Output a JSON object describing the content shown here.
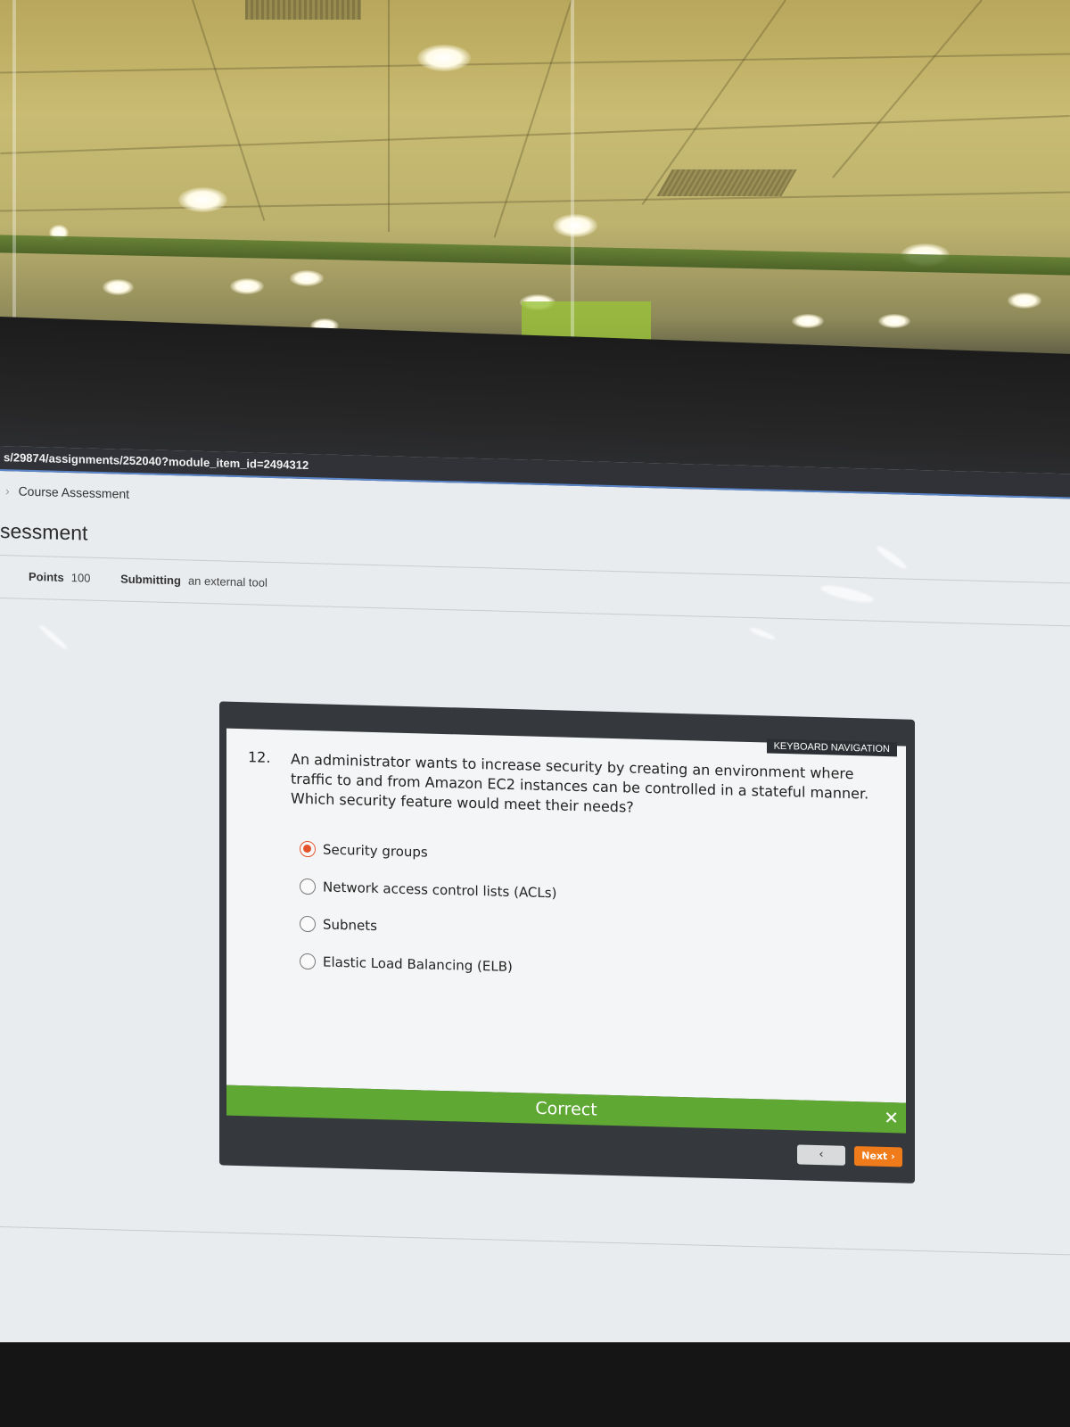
{
  "browser": {
    "url_fragment": "s/29874/assignments/252040?module_item_id=2494312"
  },
  "breadcrumb": {
    "separator": "›",
    "current": "Course Assessment"
  },
  "page": {
    "title_fragment": "sessment"
  },
  "assignment_meta": {
    "points_label": "Points",
    "points_value": "100",
    "submitting_label": "Submitting",
    "submitting_value": "an external tool"
  },
  "quiz": {
    "keyboard_nav_label": "KEYBOARD NAVIGATION",
    "question_number": "12.",
    "question_text": "An administrator wants to increase security by creating an environment where traffic to and from Amazon EC2 instances can be controlled in a stateful manner. Which security feature would meet their needs?",
    "options": [
      {
        "label": "Security groups",
        "selected": true
      },
      {
        "label": "Network access control lists (ACLs)",
        "selected": false
      },
      {
        "label": "Subnets",
        "selected": false
      },
      {
        "label": "Elastic Load Balancing (ELB)",
        "selected": false
      }
    ],
    "result_label": "Correct",
    "close_label": "✕",
    "prev_label": "‹",
    "next_label": "Next ›",
    "result_color": "#5ea833",
    "next_color": "#f07b1a",
    "selected_color": "#e5532d"
  }
}
